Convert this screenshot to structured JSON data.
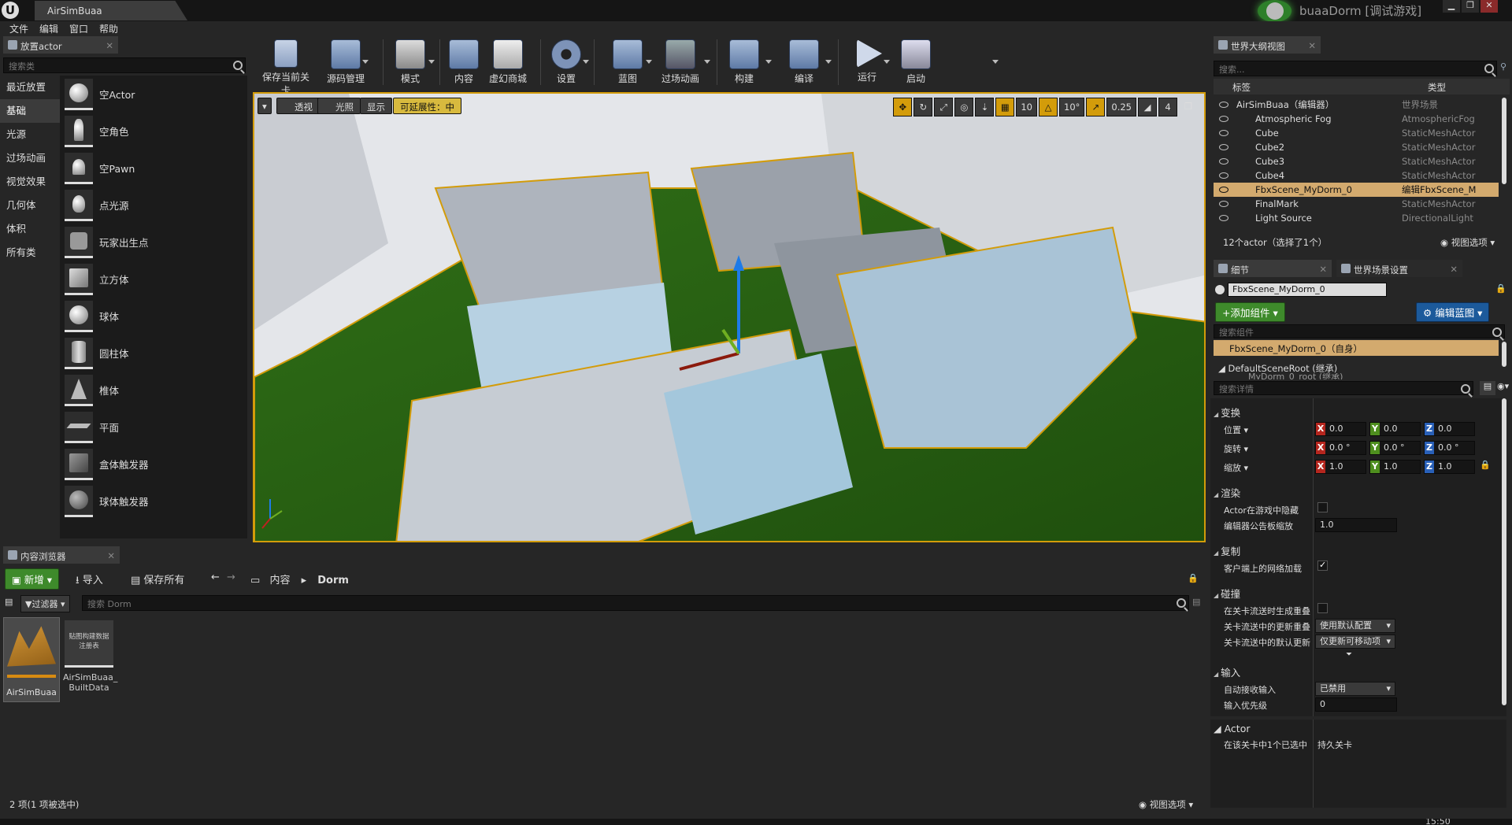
{
  "titlebar": {
    "tab": "AirSimBuaa",
    "project": "buaaDorm [调试游戏]",
    "min": "▁",
    "max": "❐",
    "close": "✕"
  },
  "menu": [
    "文件",
    "编辑",
    "窗口",
    "帮助"
  ],
  "place_panel": {
    "tab": "放置actor",
    "search_placeholder": "搜索类",
    "categories": [
      "最近放置",
      "基础",
      "光源",
      "过场动画",
      "视觉效果",
      "几何体",
      "体积",
      "所有类"
    ],
    "selected_category": "基础",
    "actors": [
      "空Actor",
      "空角色",
      "空Pawn",
      "点光源",
      "玩家出生点",
      "立方体",
      "球体",
      "圆柱体",
      "椎体",
      "平面",
      "盒体触发器",
      "球体触发器"
    ]
  },
  "toolbar": {
    "buttons": [
      "保存当前关卡",
      "源码管理",
      "模式",
      "内容",
      "虚幻商城",
      "设置",
      "蓝图",
      "过场动画",
      "构建",
      "编译",
      "运行",
      "启动"
    ]
  },
  "viewport": {
    "perspective": "透视",
    "lighting": "光照",
    "show": "显示",
    "scalability": "可延展性：中",
    "grid_snap": "10",
    "rot_snap": "10°",
    "scale_snap": "0.25",
    "cam_speed": "4"
  },
  "content_browser": {
    "tab": "内容浏览器",
    "add": "新增",
    "import": "导入",
    "save_all": "保存所有",
    "path_root": "内容",
    "path_leaf": "Dorm",
    "filters": "过滤器",
    "search_placeholder": "搜索 Dorm",
    "assets": [
      {
        "name": "AirSimBuaa",
        "thumb": ""
      },
      {
        "name": "AirSimBuaa_\nBuiltData",
        "thumb": "贴图构建数据\n注册表"
      }
    ],
    "status": "2 项(1 项被选中)",
    "view_options": "视图选项"
  },
  "outliner": {
    "tab": "世界大纲视图",
    "search_placeholder": "搜索...",
    "col_label": "标签",
    "col_type": "类型",
    "rows": [
      {
        "name": "AirSimBuaa（编辑器）",
        "type": "世界场景"
      },
      {
        "name": "Atmospheric Fog",
        "type": "AtmosphericFog"
      },
      {
        "name": "Cube",
        "type": "StaticMeshActor"
      },
      {
        "name": "Cube2",
        "type": "StaticMeshActor"
      },
      {
        "name": "Cube3",
        "type": "StaticMeshActor"
      },
      {
        "name": "Cube4",
        "type": "StaticMeshActor"
      },
      {
        "name": "FbxScene_MyDorm_0",
        "type": "编辑FbxScene_M"
      },
      {
        "name": "FinalMark",
        "type": "StaticMeshActor"
      },
      {
        "name": "Light Source",
        "type": "DirectionalLight"
      }
    ],
    "selected_row": "FbxScene_MyDorm_0",
    "status": "12个actor（选择了1个）",
    "view_options": "视图选项"
  },
  "details": {
    "tab": "细节",
    "tab2": "世界场景设置",
    "actor_name": "FbxScene_MyDorm_0",
    "add_component": "添加组件",
    "edit_blueprint": "编辑蓝图",
    "search_components": "搜索组件",
    "self": "FbxScene_MyDorm_0（自身）",
    "root": "DefaultSceneRoot (继承)",
    "root_child": "MyDorm_0_root (继承)",
    "search_details": "搜索详情",
    "transform_section": "变换",
    "location": "位置",
    "rotation": "旋转",
    "scale": "缩放",
    "loc": [
      "0.0",
      "0.0",
      "0.0"
    ],
    "rot": [
      "0.0 °",
      "0.0 °",
      "0.0 °"
    ],
    "scl": [
      "1.0",
      "1.0",
      "1.0"
    ],
    "rendering": "渲染",
    "hidden_in_game": "Actor在游戏中隐藏",
    "editor_billboard": "编辑器公告板缩放",
    "billboard_value": "1.0",
    "replication": "复制",
    "net_load": "客户端上的网络加载",
    "collision": "碰撞",
    "gen_overlap": "在关卡流送时生成重叠",
    "update_overlap": "关卡流送中的更新重叠",
    "update_overlap_value": "使用默认配置",
    "default_update": "关卡流送中的默认更新",
    "default_update_value": "仅更新可移动项",
    "input": "输入",
    "auto_receive": "自动接收输入",
    "auto_receive_value": "已禁用",
    "input_priority": "输入优先级",
    "input_priority_value": "0",
    "actor_section": "Actor",
    "selected_in_level": "在该关卡中1个已选中",
    "persistent_level": "持久关卡"
  },
  "clock": "15:50"
}
